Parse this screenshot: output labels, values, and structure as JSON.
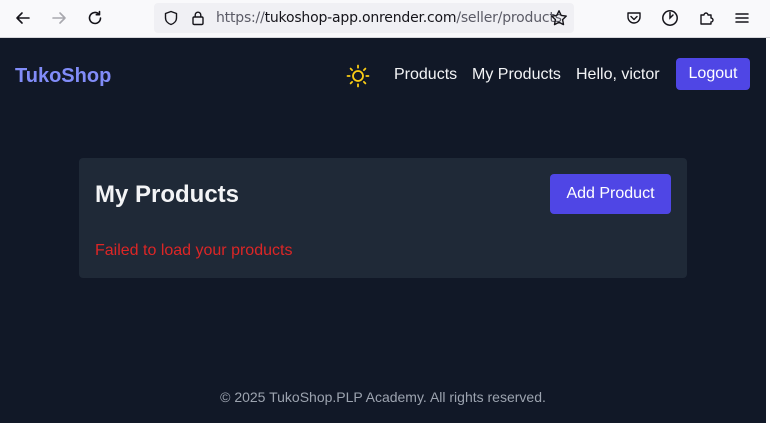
{
  "browser": {
    "url_prefix": "https://",
    "url_host": "tukoshop-app.onrender.com",
    "url_path": "/seller/products"
  },
  "navbar": {
    "brand": "TukoShop",
    "links": [
      "Products",
      "My Products",
      "Hello, victor"
    ],
    "logout": "Logout",
    "brand_color": "#818cf8",
    "sun_color": "#facc15"
  },
  "main": {
    "title": "My Products",
    "add_button": "Add Product",
    "error": "Failed to load your products",
    "error_color": "#dc2626",
    "accent": "#4f46e5"
  },
  "footer": {
    "text": "© 2025 TukoShop.PLP Academy. All rights reserved."
  }
}
